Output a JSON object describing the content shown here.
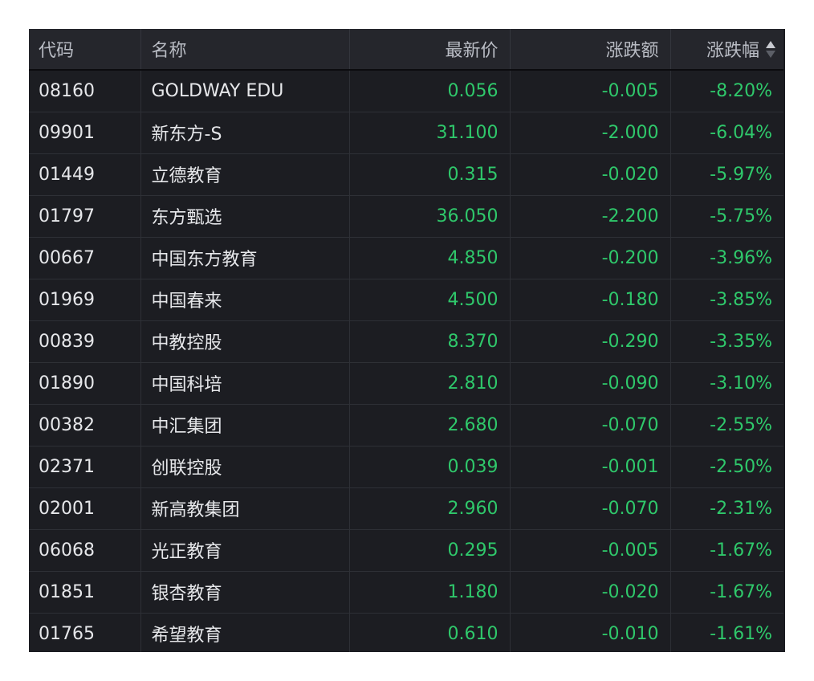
{
  "columns": {
    "code": "代码",
    "name": "名称",
    "price": "最新价",
    "change": "涨跌额",
    "change_pct": "涨跌幅"
  },
  "sort": {
    "column": "change_pct",
    "icon": "sort-icon"
  },
  "colors": {
    "down": "#2fc86b",
    "text": "#e6e7ea",
    "background": "#1c1d22"
  },
  "rows": [
    {
      "code": "08160",
      "name": "GOLDWAY EDU",
      "price": "0.056",
      "change": "-0.005",
      "change_pct": "-8.20%"
    },
    {
      "code": "09901",
      "name": "新东方-S",
      "price": "31.100",
      "change": "-2.000",
      "change_pct": "-6.04%"
    },
    {
      "code": "01449",
      "name": "立德教育",
      "price": "0.315",
      "change": "-0.020",
      "change_pct": "-5.97%"
    },
    {
      "code": "01797",
      "name": "东方甄选",
      "price": "36.050",
      "change": "-2.200",
      "change_pct": "-5.75%"
    },
    {
      "code": "00667",
      "name": "中国东方教育",
      "price": "4.850",
      "change": "-0.200",
      "change_pct": "-3.96%"
    },
    {
      "code": "01969",
      "name": "中国春来",
      "price": "4.500",
      "change": "-0.180",
      "change_pct": "-3.85%"
    },
    {
      "code": "00839",
      "name": "中教控股",
      "price": "8.370",
      "change": "-0.290",
      "change_pct": "-3.35%"
    },
    {
      "code": "01890",
      "name": "中国科培",
      "price": "2.810",
      "change": "-0.090",
      "change_pct": "-3.10%"
    },
    {
      "code": "00382",
      "name": "中汇集团",
      "price": "2.680",
      "change": "-0.070",
      "change_pct": "-2.55%"
    },
    {
      "code": "02371",
      "name": "创联控股",
      "price": "0.039",
      "change": "-0.001",
      "change_pct": "-2.50%"
    },
    {
      "code": "02001",
      "name": "新高教集团",
      "price": "2.960",
      "change": "-0.070",
      "change_pct": "-2.31%"
    },
    {
      "code": "06068",
      "name": "光正教育",
      "price": "0.295",
      "change": "-0.005",
      "change_pct": "-1.67%"
    },
    {
      "code": "01851",
      "name": "银杏教育",
      "price": "1.180",
      "change": "-0.020",
      "change_pct": "-1.67%"
    },
    {
      "code": "01765",
      "name": "希望教育",
      "price": "0.610",
      "change": "-0.010",
      "change_pct": "-1.61%"
    }
  ]
}
